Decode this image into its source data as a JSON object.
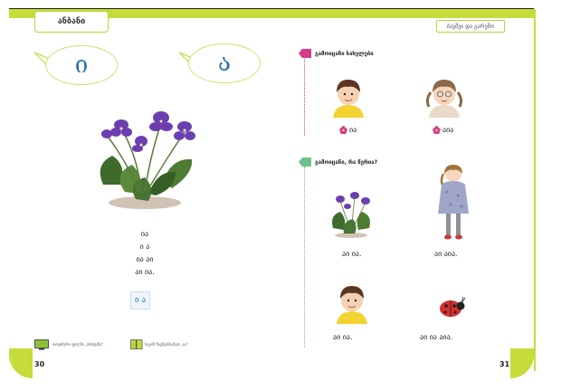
{
  "header": {
    "chapter_title": "ანბანი",
    "section_title": "ბავშვი და გარემო"
  },
  "left_page": {
    "bubble_letters": [
      "ი",
      "ა"
    ],
    "word_list": [
      "ია",
      "ი ა",
      "ია აი",
      "აი ია."
    ],
    "letter_card": "ი ა",
    "footnotes": [
      "თოჯინური ფილმი „ბოსტანი“.",
      "საკონ წიგნებისაზეთ „ია“."
    ],
    "page_number": "30"
  },
  "right_page": {
    "task_1": {
      "label": "გამოიცანი სახელები",
      "captions": [
        "ია",
        "აია"
      ]
    },
    "task_2": {
      "label": "გამოიცანი, რა წერია?",
      "captions": [
        "აი ია.",
        "აი აია.",
        "აი ია.",
        "აი ია აია."
      ]
    },
    "page_number": "31"
  },
  "colors": {
    "accent_green": "#c6dc38",
    "task_pink": "#d63a8a",
    "task_green": "#6cc08c",
    "letter_blue": "#2a6fb0"
  },
  "icons": [
    "tv-icon",
    "book-icon",
    "flower-icon",
    "pink-flower-icon",
    "green-flower-icon"
  ]
}
